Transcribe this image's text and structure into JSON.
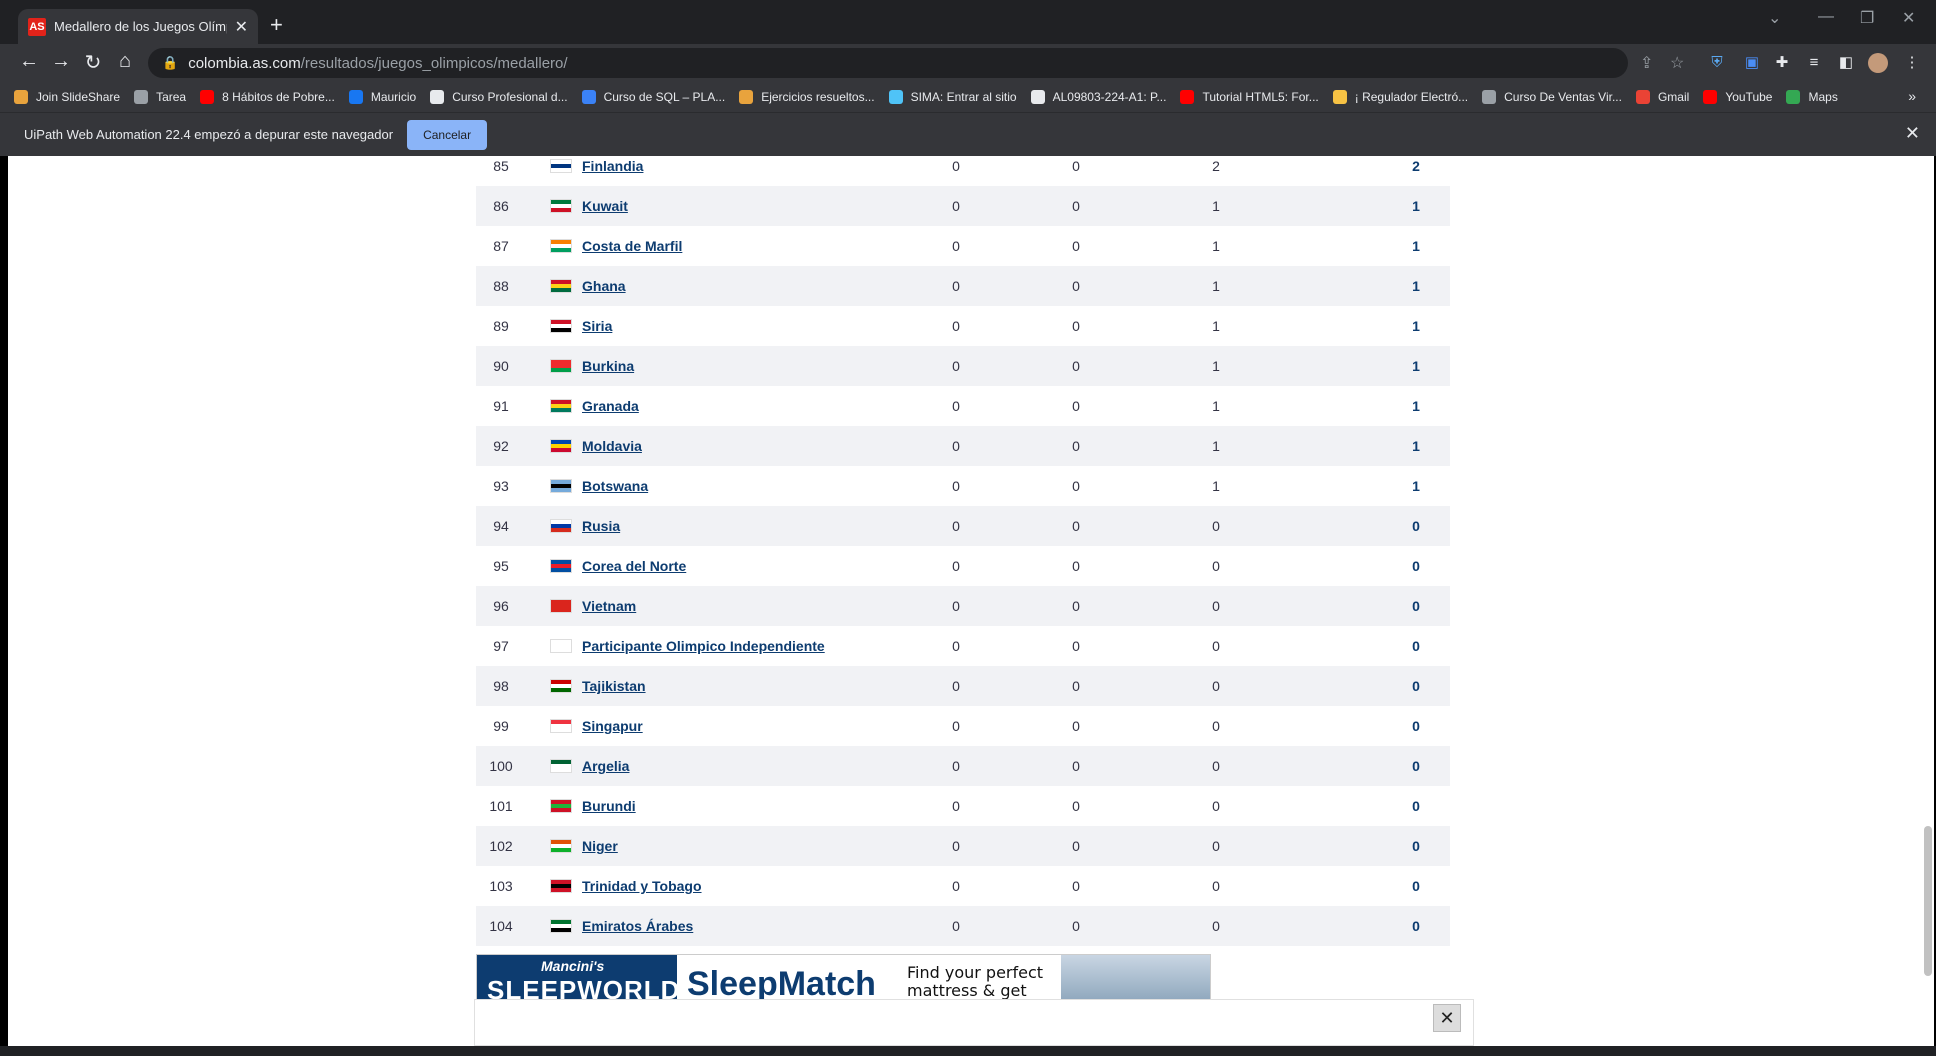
{
  "browser": {
    "tab_title": "Medallero de los Juegos Olímpic",
    "tab_favicon_text": "AS",
    "url_host": "colombia.as.com",
    "url_path": "/resultados/juegos_olimpicos/medallero/"
  },
  "bookmarks": [
    {
      "label": "Join SlideShare",
      "color": "#e8a33d"
    },
    {
      "label": "Tarea",
      "color": "#9aa0a6"
    },
    {
      "label": "8 Hábitos de Pobre...",
      "color": "#ff0000"
    },
    {
      "label": "Mauricio",
      "color": "#1877f2"
    },
    {
      "label": "Curso Profesional d...",
      "color": "#e8eaed"
    },
    {
      "label": "Curso de SQL – PLA...",
      "color": "#3b82f6"
    },
    {
      "label": "Ejercicios resueltos...",
      "color": "#e8a33d"
    },
    {
      "label": "SIMA: Entrar al sitio",
      "color": "#4fc3f7"
    },
    {
      "label": "AL09803-224-A1: P...",
      "color": "#e8eaed"
    },
    {
      "label": "Tutorial HTML5: For...",
      "color": "#ff0000"
    },
    {
      "label": "¡ Regulador Electró...",
      "color": "#f6c244"
    },
    {
      "label": "Curso De Ventas Vir...",
      "color": "#9aa0a6"
    },
    {
      "label": "Gmail",
      "color": "#ea4335"
    },
    {
      "label": "YouTube",
      "color": "#ff0000"
    },
    {
      "label": "Maps",
      "color": "#34a853"
    }
  ],
  "infobar": {
    "message": "UiPath Web Automation 22.4 empezó a depurar este navegador",
    "cancel_label": "Cancelar"
  },
  "medal_table": {
    "rows": [
      {
        "rank": "85",
        "country": "Finlandia",
        "gold": "0",
        "silver": "0",
        "bronze": "2",
        "total": "2",
        "flag": [
          "#ffffff",
          "#003580",
          "#ffffff"
        ]
      },
      {
        "rank": "86",
        "country": "Kuwait",
        "gold": "0",
        "silver": "0",
        "bronze": "1",
        "total": "1",
        "flag": [
          "#007a3d",
          "#ffffff",
          "#ce1126"
        ]
      },
      {
        "rank": "87",
        "country": "Costa de Marfil",
        "gold": "0",
        "silver": "0",
        "bronze": "1",
        "total": "1",
        "flag": [
          "#f77f00",
          "#ffffff",
          "#009e60"
        ]
      },
      {
        "rank": "88",
        "country": "Ghana",
        "gold": "0",
        "silver": "0",
        "bronze": "1",
        "total": "1",
        "flag": [
          "#ce1126",
          "#fcd116",
          "#006b3f"
        ]
      },
      {
        "rank": "89",
        "country": "Siria",
        "gold": "0",
        "silver": "0",
        "bronze": "1",
        "total": "1",
        "flag": [
          "#ce1126",
          "#ffffff",
          "#000000"
        ]
      },
      {
        "rank": "90",
        "country": "Burkina",
        "gold": "0",
        "silver": "0",
        "bronze": "1",
        "total": "1",
        "flag": [
          "#ef2b2d",
          "#ef2b2d",
          "#009e49"
        ]
      },
      {
        "rank": "91",
        "country": "Granada",
        "gold": "0",
        "silver": "0",
        "bronze": "1",
        "total": "1",
        "flag": [
          "#ce1126",
          "#fcd116",
          "#007a5e"
        ]
      },
      {
        "rank": "92",
        "country": "Moldavia",
        "gold": "0",
        "silver": "0",
        "bronze": "1",
        "total": "1",
        "flag": [
          "#0046ae",
          "#ffd200",
          "#cc092f"
        ]
      },
      {
        "rank": "93",
        "country": "Botswana",
        "gold": "0",
        "silver": "0",
        "bronze": "1",
        "total": "1",
        "flag": [
          "#75aadb",
          "#000000",
          "#75aadb"
        ]
      },
      {
        "rank": "94",
        "country": "Rusia",
        "gold": "0",
        "silver": "0",
        "bronze": "0",
        "total": "0",
        "flag": [
          "#ffffff",
          "#0039a6",
          "#d52b1e"
        ]
      },
      {
        "rank": "95",
        "country": "Corea del Norte",
        "gold": "0",
        "silver": "0",
        "bronze": "0",
        "total": "0",
        "flag": [
          "#024fa2",
          "#ed1c27",
          "#024fa2"
        ]
      },
      {
        "rank": "96",
        "country": "Vietnam",
        "gold": "0",
        "silver": "0",
        "bronze": "0",
        "total": "0",
        "flag": [
          "#da251d",
          "#da251d",
          "#da251d"
        ]
      },
      {
        "rank": "97",
        "country": "Participante Olimpico Independiente",
        "gold": "0",
        "silver": "0",
        "bronze": "0",
        "total": "0",
        "flag": [
          "#ffffff",
          "#ffffff",
          "#ffffff"
        ]
      },
      {
        "rank": "98",
        "country": "Tajikistan",
        "gold": "0",
        "silver": "0",
        "bronze": "0",
        "total": "0",
        "flag": [
          "#cc0000",
          "#ffffff",
          "#006600"
        ]
      },
      {
        "rank": "99",
        "country": "Singapur",
        "gold": "0",
        "silver": "0",
        "bronze": "0",
        "total": "0",
        "flag": [
          "#ef3340",
          "#ffffff",
          "#ffffff"
        ]
      },
      {
        "rank": "100",
        "country": "Argelia",
        "gold": "0",
        "silver": "0",
        "bronze": "0",
        "total": "0",
        "flag": [
          "#006233",
          "#ffffff",
          "#ffffff"
        ]
      },
      {
        "rank": "101",
        "country": "Burundi",
        "gold": "0",
        "silver": "0",
        "bronze": "0",
        "total": "0",
        "flag": [
          "#ce1126",
          "#1eb53a",
          "#ce1126"
        ]
      },
      {
        "rank": "102",
        "country": "Niger",
        "gold": "0",
        "silver": "0",
        "bronze": "0",
        "total": "0",
        "flag": [
          "#e05206",
          "#ffffff",
          "#0db02b"
        ]
      },
      {
        "rank": "103",
        "country": "Trinidad y Tobago",
        "gold": "0",
        "silver": "0",
        "bronze": "0",
        "total": "0",
        "flag": [
          "#ce1126",
          "#000000",
          "#ce1126"
        ]
      },
      {
        "rank": "104",
        "country": "Emiratos Árabes",
        "gold": "0",
        "silver": "0",
        "bronze": "0",
        "total": "0",
        "flag": [
          "#00732f",
          "#ffffff",
          "#000000"
        ]
      }
    ]
  },
  "ad": {
    "brand_line1": "Mancini's",
    "brand_line2": "SLEEPWORLD",
    "product": "SleepMatch",
    "tagline1": "Find your perfect",
    "tagline2": "mattress & get"
  }
}
